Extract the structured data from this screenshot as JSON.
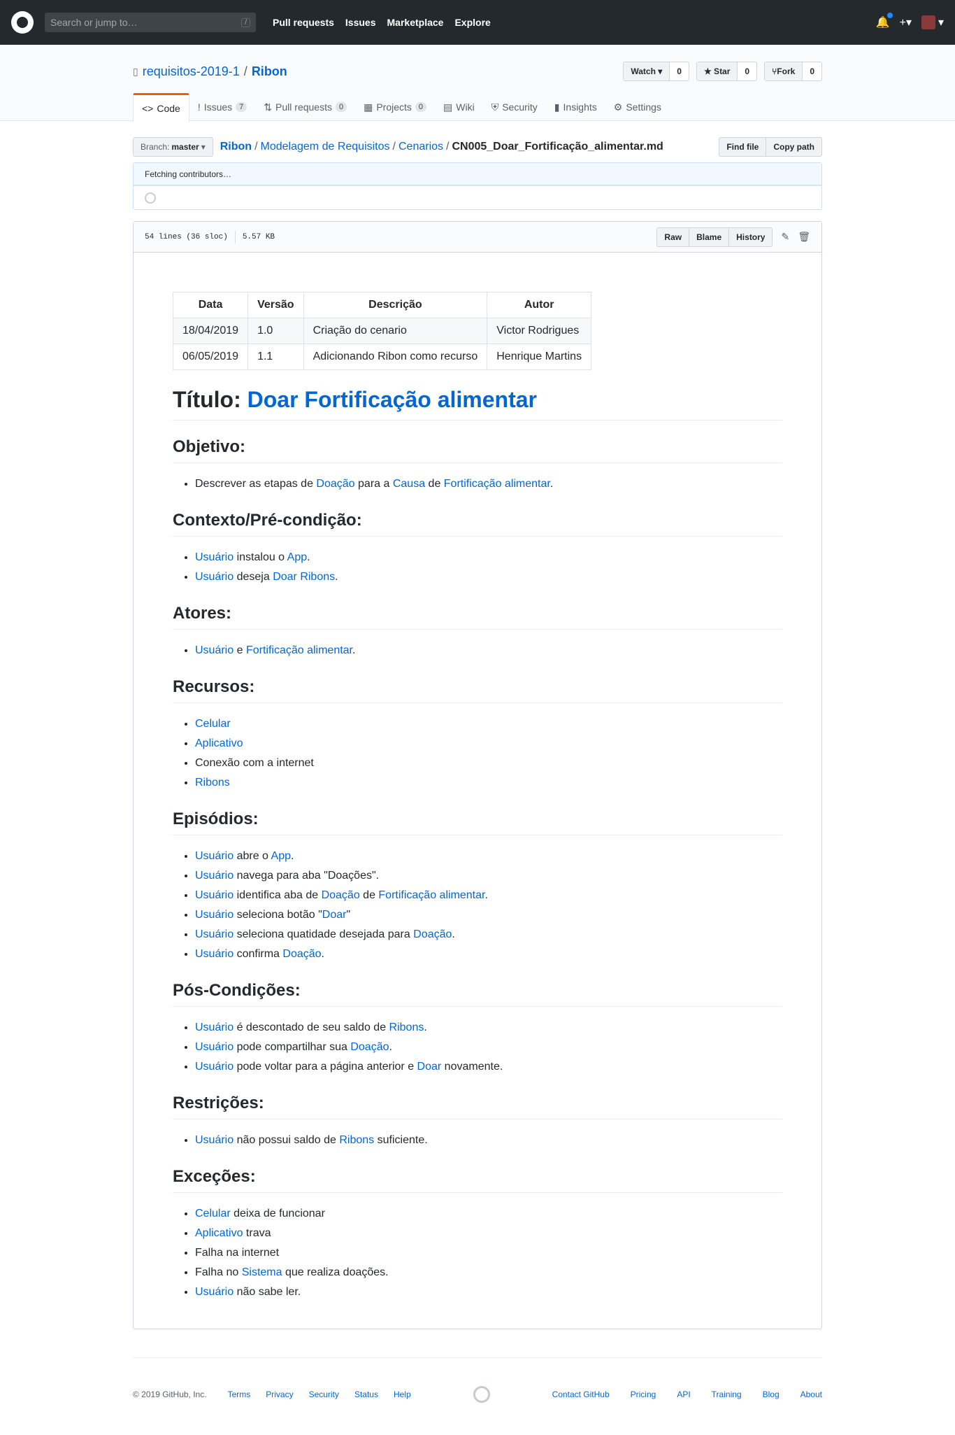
{
  "header": {
    "search_placeholder": "Search or jump to…",
    "slash": "/",
    "nav": [
      "Pull requests",
      "Issues",
      "Marketplace",
      "Explore"
    ],
    "plus": "+▾",
    "caret": "▾"
  },
  "repo": {
    "owner": "requisitos-2019-1",
    "sep": "/",
    "name": "Ribon",
    "watch": "Watch ▾",
    "watch_count": "0",
    "star": "★ Star",
    "star_count": "0",
    "fork": "Fork",
    "fork_count": "0",
    "tabs": [
      {
        "label": "Code",
        "icon": "<>"
      },
      {
        "label": "Issues",
        "count": "7",
        "icon": "!"
      },
      {
        "label": "Pull requests",
        "count": "0",
        "icon": "⇅"
      },
      {
        "label": "Projects",
        "count": "0",
        "icon": "▦"
      },
      {
        "label": "Wiki",
        "icon": "▤"
      },
      {
        "label": "Security",
        "icon": "⛨"
      },
      {
        "label": "Insights",
        "icon": "▮"
      },
      {
        "label": "Settings",
        "icon": "⚙"
      }
    ]
  },
  "filenav": {
    "branch_label": "Branch:",
    "branch": "master",
    "crumbs": [
      "Ribon",
      "Modelagem de Requisitos",
      "Cenarios"
    ],
    "file": "CN005_Doar_Fortificação_alimentar.md",
    "find": "Find file",
    "copy": "Copy path"
  },
  "contributors": {
    "text": "Fetching contributors…"
  },
  "fileinfo": {
    "lines": "54 lines (36 sloc)",
    "size": "5.57 KB",
    "raw": "Raw",
    "blame": "Blame",
    "history": "History"
  },
  "doc": {
    "table": {
      "headers": [
        "Data",
        "Versão",
        "Descrição",
        "Autor"
      ],
      "rows": [
        [
          "18/04/2019",
          "1.0",
          "Criação do cenario",
          "Victor Rodrigues"
        ],
        [
          "06/05/2019",
          "1.1",
          "Adicionando Ribon como recurso",
          "Henrique Martins"
        ]
      ]
    },
    "title_prefix": "Título: ",
    "title_link": "Doar Fortificação alimentar",
    "h_obj": "Objetivo:",
    "h_ctx": "Contexto/Pré-condição:",
    "h_atores": "Atores:",
    "h_rec": "Recursos:",
    "h_ep": "Episódios:",
    "h_pos": "Pós-Condições:",
    "h_res": "Restrições:",
    "h_exc": "Exceções:",
    "obj": [
      "Descrever as etapas de ",
      "Doação",
      " para a ",
      "Causa",
      " de ",
      "Fortificação alimentar",
      "."
    ],
    "ctx1": [
      "Usuário",
      " instalou o ",
      "App",
      "."
    ],
    "ctx2": [
      "Usuário",
      " deseja ",
      "Doar Ribons",
      "."
    ],
    "atores": [
      "Usuário",
      " e ",
      "Fortificação alimentar",
      "."
    ],
    "rec": [
      "Celular",
      "Aplicativo",
      "Conexão com a internet",
      "Ribons"
    ],
    "ep1": [
      "Usuário",
      " abre o ",
      "App",
      "."
    ],
    "ep2": [
      "Usuário",
      " navega para aba \"Doações\"."
    ],
    "ep3": [
      "Usuário",
      " identifica aba de ",
      "Doação",
      " de ",
      "Fortificação alimentar",
      "."
    ],
    "ep4": [
      "Usuário",
      " seleciona botão \"",
      "Doar",
      "\""
    ],
    "ep5": [
      "Usuário",
      " seleciona quatidade desejada para ",
      "Doação",
      "."
    ],
    "ep6": [
      "Usuário",
      " confirma ",
      "Doação",
      "."
    ],
    "pos1": [
      "Usuário",
      " é descontado de seu saldo de ",
      "Ribons",
      "."
    ],
    "pos2": [
      "Usuário",
      " pode compartilhar sua ",
      "Doação",
      "."
    ],
    "pos3": [
      "Usuário",
      " pode voltar para a página anterior e ",
      "Doar",
      " novamente."
    ],
    "res1": [
      "Usuário",
      " não possui saldo de ",
      "Ribons",
      " suficiente."
    ],
    "exc1": [
      "Celular",
      " deixa de funcionar"
    ],
    "exc2": [
      "Aplicativo",
      " trava"
    ],
    "exc3": "Falha na internet",
    "exc4": [
      "Falha no ",
      "Sistema",
      " que realiza doações."
    ],
    "exc5": [
      "Usuário",
      " não sabe ler."
    ]
  },
  "footer": {
    "copy": "© 2019 GitHub, Inc.",
    "left": [
      "Terms",
      "Privacy",
      "Security",
      "Status",
      "Help"
    ],
    "right": [
      "Contact GitHub",
      "Pricing",
      "API",
      "Training",
      "Blog",
      "About"
    ]
  }
}
